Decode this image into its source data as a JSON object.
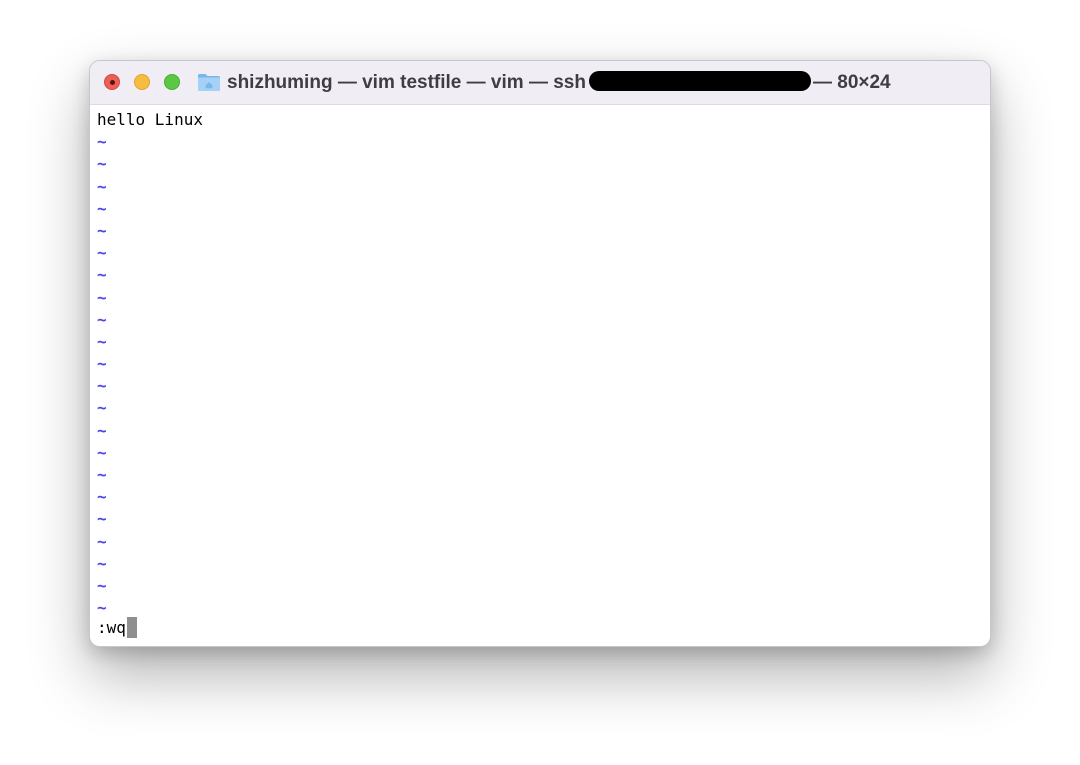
{
  "window": {
    "title_before": "shizhuming — vim testfile — vim — ssh",
    "title_after": "— 80×24"
  },
  "editor": {
    "first_line": "hello Linux",
    "tilde": "~",
    "command": ":wq"
  },
  "icons": {
    "folder": "folder-icon",
    "close": "close-icon",
    "minimize": "minimize-icon",
    "maximize": "maximize-icon"
  },
  "colors": {
    "tilde": "#4a45e8",
    "close": "#ec5f57",
    "minimize": "#f5bd42",
    "maximize": "#5cc645"
  }
}
